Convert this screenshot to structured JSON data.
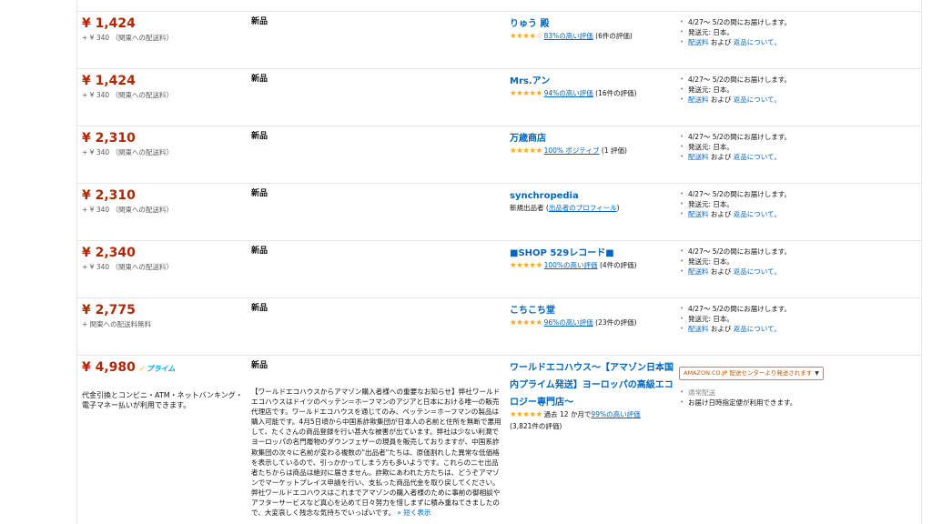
{
  "offers": [
    {
      "price": "¥ 1,424",
      "shipping": "+ ¥ 340 （関東への配送料）",
      "condition": "新品",
      "seller": "りゅう 殿",
      "stars": "★★★★☆",
      "rating_pct": "83%の高い評価",
      "rating_count": "(6件の評価)",
      "delivery": [
        "4/27～ 5/2の間にお届けします。",
        "発送元: 日本。"
      ],
      "shipping_link": "配送料",
      "and_text": " および ",
      "returns_link": "返品について。"
    },
    {
      "price": "¥ 1,424",
      "shipping": "+ ¥ 340 （関東への配送料）",
      "condition": "新品",
      "seller": "Mrs.アン",
      "stars": "★★★★★",
      "rating_pct": "94%の高い評価",
      "rating_count": "(16件の評価)",
      "delivery": [
        "4/27～ 5/2の間にお届けします。",
        "発送元: 日本。"
      ],
      "shipping_link": "配送料",
      "and_text": " および ",
      "returns_link": "返品について。"
    },
    {
      "price": "¥ 2,310",
      "shipping": "+ ¥ 340 （関東への配送料）",
      "condition": "新品",
      "seller": "万歳商店",
      "stars": "★★★★★",
      "rating_pct": "100% ポジティブ",
      "rating_count": "(1 評価)",
      "delivery": [
        "4/27～ 5/2の間にお届けします。",
        "発送元: 日本。"
      ],
      "shipping_link": "配送料",
      "and_text": " および ",
      "returns_link": "返品について。"
    },
    {
      "price": "¥ 2,310",
      "shipping": "+ ¥ 340 （関東への配送料）",
      "condition": "新品",
      "seller": "synchropedia",
      "new_seller_label": "新規出品者 (",
      "new_seller_link": "出品者のプロフィール",
      "new_seller_close": ")",
      "delivery": [
        "4/27～ 5/2の間にお届けします。",
        "発送元: 日本。"
      ],
      "shipping_link": "配送料",
      "and_text": " および ",
      "returns_link": "返品について。"
    },
    {
      "price": "¥ 2,340",
      "shipping": "+ ¥ 340 （関東への配送料）",
      "condition": "新品",
      "seller": "■SHOP 529レコード■",
      "stars": "★★★★★",
      "rating_pct": "100%の高い評価",
      "rating_count": "(4件の評価)",
      "delivery": [
        "4/27～ 5/2の間にお届けします。",
        "発送元: 日本。"
      ],
      "shipping_link": "配送料",
      "and_text": " および ",
      "returns_link": "返品について。"
    },
    {
      "price": "¥ 2,775",
      "shipping": "+ 関東への配送料無料",
      "condition": "新品",
      "seller": "こちこち堂",
      "stars": "★★★★★",
      "rating_pct": "96%の高い評価",
      "rating_count": "(23件の評価)",
      "delivery": [
        "4/27～ 5/2の間にお届けします。",
        "発送元: 日本。"
      ],
      "shipping_link": "配送料",
      "and_text": " および ",
      "returns_link": "返品について。"
    },
    {
      "price": "¥ 4,980",
      "prime_check": "✓",
      "prime_label": "プライム",
      "payment": "代金引換とコンビニ・ATM・ネットバンキング・電子マネー払いが利用できます。",
      "condition": "新品",
      "description": "【ワールドエコハウスからアマゾン購入者様への重要なお知らせ】弊社ワールドエコハウスはドイツのペッテン＝ホーフマンのアジアと日本における唯一の販売代理店です。ワールドエコハウスを通じてのみ、ペッテン＝ホーフマンの製品は購入可能です。4月5日頃から中国系詐欺集団が日本人の名前と住所を無断で悪用して、たくさんの商品登録を行い甚大な被害が出ています。弊社は少ない利潤でヨーロッパの名門履物のダウンフェザーの現員を販売しておりますが、中国系詐欺集団の次々に名前が変わる複数の\"出品者\"たちは、原価割れした異常な低価格を表示しているので、引っかかってしまう方も多いようです。これらの二セ出品者たちからは商品は絶対に届きません。詐欺にあわれた方たちは、どうぞアマゾンでマーケットプレイス申請を行い、支払った商品代金を取り戻してください。弊社ワールドエコハウスはこれまでアマゾンの購入者様のために事前の御相談やアフターサービスなど真心を込めて日々努力を惜しまずに積み重ねてきましたので、大変哀しく残念な気持ちでいっぱいです。",
      "more_link": "» 短く表示",
      "seller": "ワールドエコハウス～【アマゾン日本国内プライム発送】ヨーロッパの高級エコロジー専門店～",
      "stars": "★★★★★",
      "rating_prefix": "過去 12 か月で",
      "rating_pct": "99%の高い評価",
      "rating_count": "(3,821件の評価)",
      "fc_label": "AMAZON.CO.JP 配送センターより発送されます",
      "fc_caret": "▼",
      "delivery_muted": "通常配送",
      "delivery": [
        "お届け日時指定便が利用できます。"
      ]
    }
  ],
  "colors": {
    "price": "#b12704",
    "link": "#0066c0",
    "star": "#ffa41c",
    "prime": "#00a8e1",
    "fc": "#c45500"
  }
}
